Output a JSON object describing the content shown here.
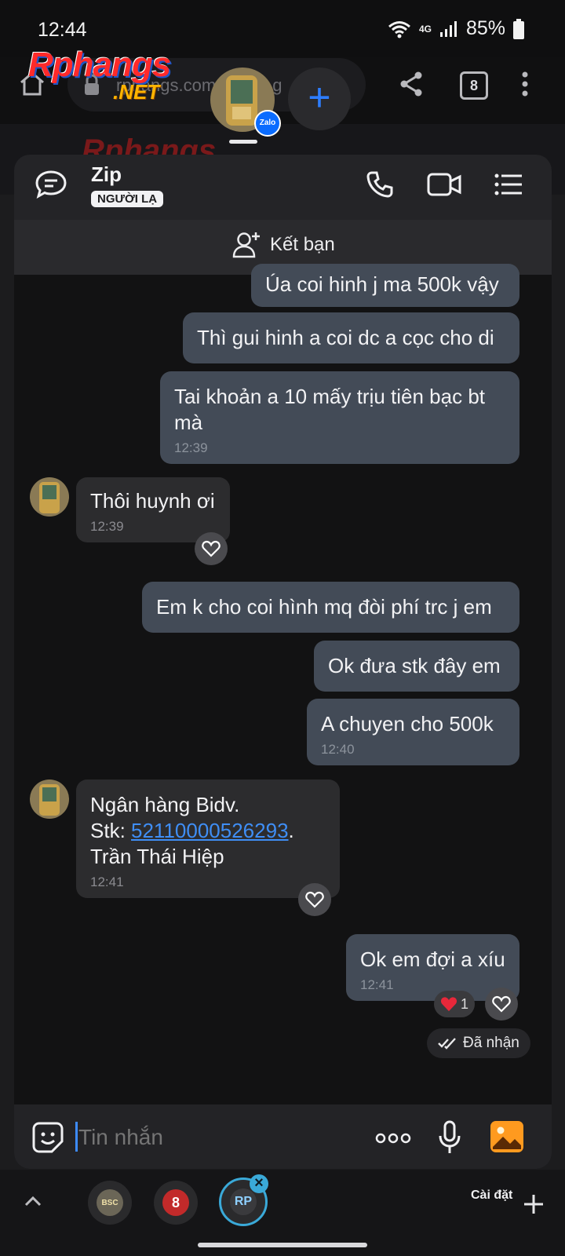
{
  "status_bar": {
    "time": "12:44",
    "network": "4G",
    "battery": "85%"
  },
  "browser": {
    "url": "rphangs.com/...es/...g",
    "tab_count": "8",
    "site_logo": {
      "main": "Rphangs",
      "suffix": ".NET"
    }
  },
  "chat_bubble": {
    "badge": "Zalo"
  },
  "chat": {
    "header": {
      "name": "Zip",
      "badge": "NGƯỜI LẠ"
    },
    "add_friend_label": "Kết bạn",
    "messages": [
      {
        "direction": "out",
        "text": "Úa coi hinh j ma 500k vậy"
      },
      {
        "direction": "out",
        "text": "Thì gui hinh a coi dc a cọc cho di"
      },
      {
        "direction": "out",
        "text": "Tai khoản a 10 mấy trịu tiên bạc bt mà",
        "time": "12:39"
      },
      {
        "direction": "in",
        "text": "Thôi huynh ơi",
        "time": "12:39"
      },
      {
        "direction": "out",
        "text": "Em k cho coi hình mq đòi phí trc j em"
      },
      {
        "direction": "out",
        "text": "Ok đưa stk đây em"
      },
      {
        "direction": "out",
        "text": "A chuyen cho 500k",
        "time": "12:40"
      },
      {
        "direction": "in",
        "line1": "Ngân hàng Bidv.",
        "line2_prefix": "Stk: ",
        "account": "52110000526293",
        "line2_suffix": ".",
        "line3": "Trần Thái Hiệp",
        "time": "12:41"
      },
      {
        "direction": "out",
        "text": "Ok em đợi a xíu",
        "time": "12:41"
      }
    ],
    "reaction_count": "1",
    "status_received": "Đã nhận",
    "composer": {
      "placeholder": "Tin nhắn"
    }
  },
  "tray": {
    "settings_label": "Cài đặt",
    "bubbles": [
      "BSC",
      "8",
      "RP"
    ]
  },
  "colors": {
    "accent": "#2d7dff",
    "outgoing_bubble": "#434b57",
    "incoming_bubble": "#2c2c2e",
    "link": "#3f8ef5"
  }
}
